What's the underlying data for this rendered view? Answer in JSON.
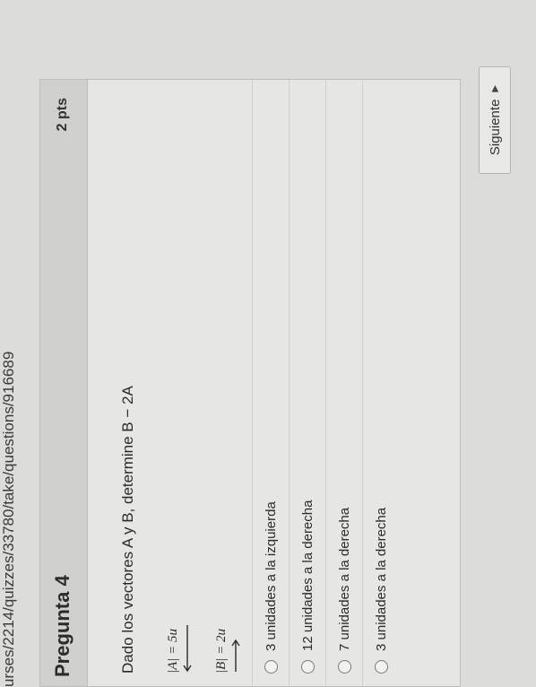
{
  "url": "urses/2214/quizzes/33780/take/questions/916689",
  "question": {
    "title": "Pregunta 4",
    "points": "2 pts",
    "text": "Dado los vectores A y B, determine B − 2A",
    "vector_a": "|A| = 5u",
    "vector_b": "|B| = 2u"
  },
  "options": [
    {
      "label": "3 unidades a la izquierda"
    },
    {
      "label": "12 unidades a la derecha"
    },
    {
      "label": "7 unidades a la derecha"
    },
    {
      "label": "3 unidades a la derecha"
    }
  ],
  "next_button": {
    "label": "Siguiente"
  }
}
